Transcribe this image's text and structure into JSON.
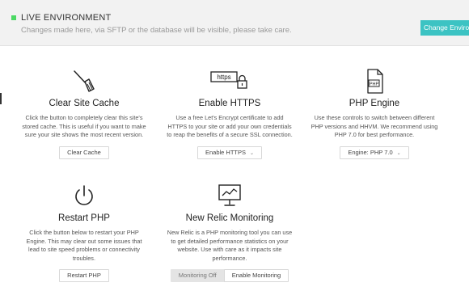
{
  "environment": {
    "title": "LIVE ENVIRONMENT",
    "description": "Changes made here, via SFTP or the database will be visible, please take care.",
    "change_button": "Change Environment",
    "status_color": "#4cd964",
    "accent_color": "#3cc3c3"
  },
  "tools": [
    {
      "icon": "broom-icon",
      "title": "Clear Site Cache",
      "description": "Click the button to completely clear this site's stored cache. This is useful if you want to make sure your site shows the most recent version.",
      "button": "Clear Cache"
    },
    {
      "icon": "https-lock-icon",
      "icon_text": "https",
      "title": "Enable HTTPS",
      "description": "Use a free Let's Encrypt certificate to add HTTPS to your site or add your own credentials to reap the benefits of a secure SSL connection.",
      "button": "Enable HTTPS"
    },
    {
      "icon": "php-file-icon",
      "icon_text": "PHP",
      "title": "PHP Engine",
      "description": "Use these controls to switch between different PHP versions and HHVM. We recommend using PHP 7.0 for best performance.",
      "button": "Engine: PHP 7.0"
    },
    {
      "icon": "power-icon",
      "title": "Restart PHP",
      "description": "Click the button below to restart your PHP Engine. This may clear out some issues that lead to site speed problems or connectivity troubles.",
      "button": "Restart PHP"
    },
    {
      "icon": "monitor-chart-icon",
      "title": "New Relic Monitoring",
      "description": "New Relic is a PHP monitoring tool you can use to get detailed performance statistics on your website. Use with care as it impacts site performance.",
      "buttons": [
        "Monitoring Off",
        "Enable Monitoring"
      ]
    }
  ]
}
